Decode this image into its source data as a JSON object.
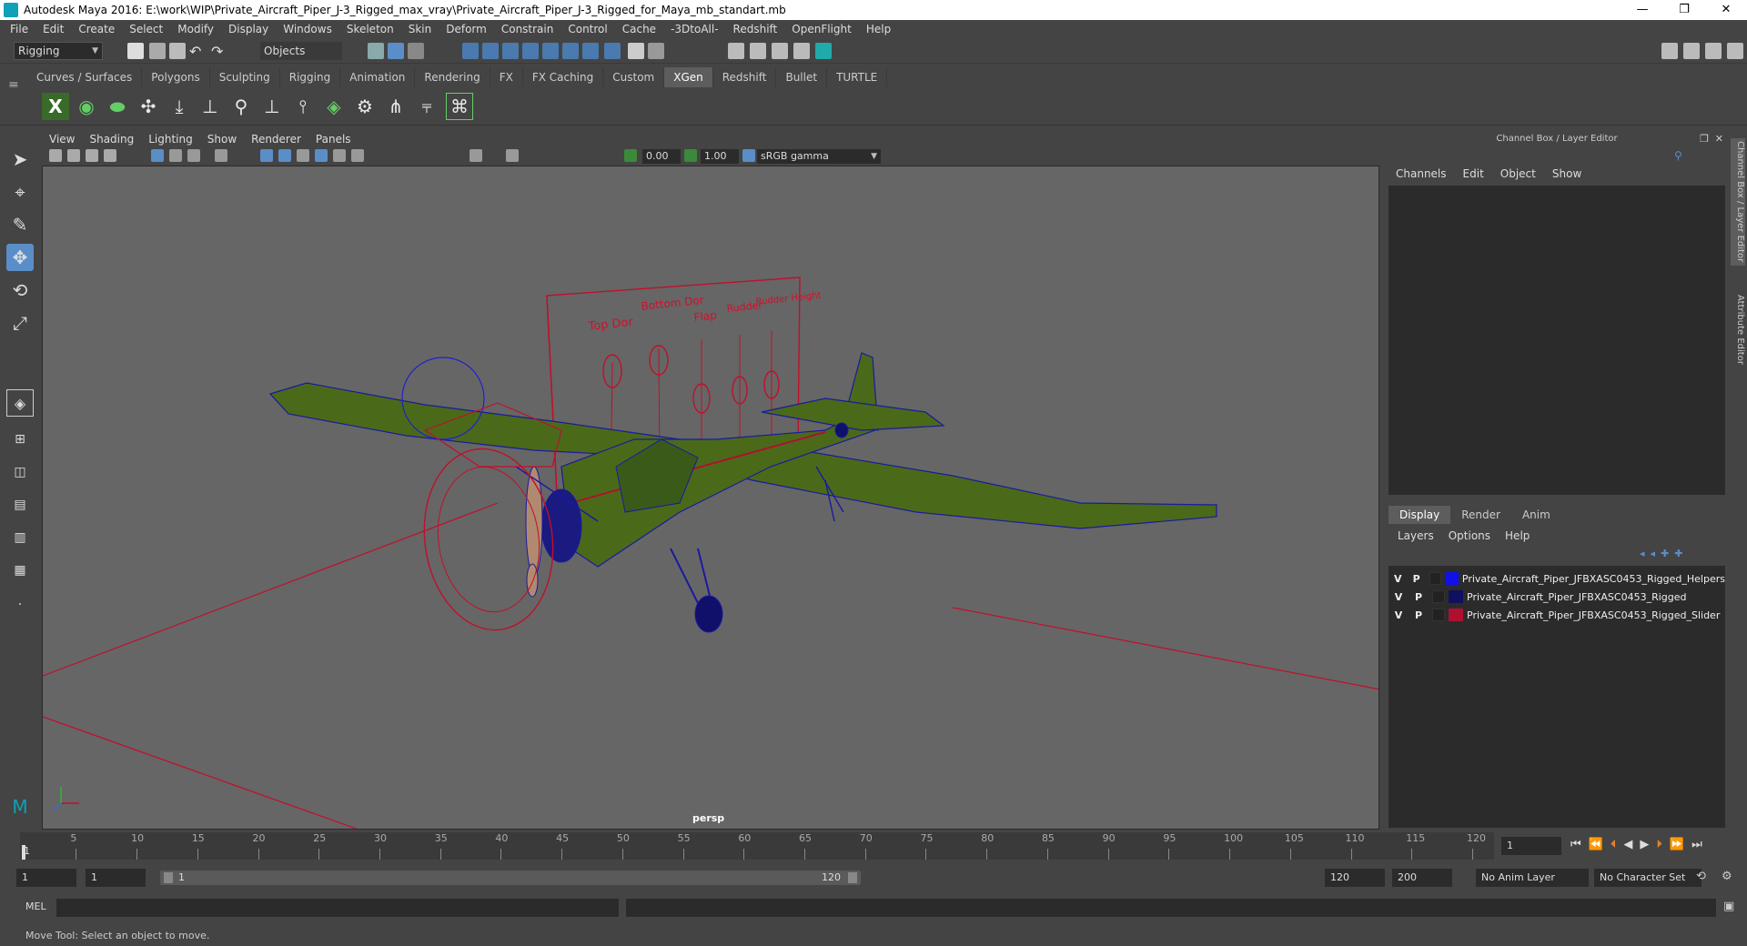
{
  "window": {
    "title": "Autodesk Maya 2016: E:\\work\\WIP\\Private_Aircraft_Piper_J-3_Rigged_max_vray\\Private_Aircraft_Piper_J-3_Rigged_for_Maya_mb_standart.mb",
    "minimize": "—",
    "restore": "❐",
    "close": "✕"
  },
  "menubar": [
    "File",
    "Edit",
    "Create",
    "Select",
    "Modify",
    "Display",
    "Windows",
    "Skeleton",
    "Skin",
    "Deform",
    "Constrain",
    "Control",
    "Cache",
    "-3DtoAll-",
    "Redshift",
    "OpenFlight",
    "Help"
  ],
  "statusline": {
    "mode": "Rigging",
    "selection_mode": "Objects"
  },
  "shelf_tabs": [
    {
      "label": "Curves / Surfaces",
      "active": false
    },
    {
      "label": "Polygons",
      "active": false
    },
    {
      "label": "Sculpting",
      "active": false
    },
    {
      "label": "Rigging",
      "active": false
    },
    {
      "label": "Animation",
      "active": false
    },
    {
      "label": "Rendering",
      "active": false
    },
    {
      "label": "FX",
      "active": false
    },
    {
      "label": "FX Caching",
      "active": false
    },
    {
      "label": "Custom",
      "active": false
    },
    {
      "label": "XGen",
      "active": true
    },
    {
      "label": "Redshift",
      "active": false
    },
    {
      "label": "Bullet",
      "active": false
    },
    {
      "label": "TURTLE",
      "active": false
    }
  ],
  "viewport": {
    "menu": [
      "View",
      "Shading",
      "Lighting",
      "Show",
      "Renderer",
      "Panels"
    ],
    "exposure": "0.00",
    "gamma": "1.00",
    "color_space": "sRGB gamma",
    "camera_label": "persp"
  },
  "slider_board": {
    "labels": [
      "Top Dor",
      "Bottom Dor",
      "Flap",
      "Rudder",
      "Rudder Height"
    ]
  },
  "channel_box": {
    "header": "Channel Box / Layer Editor",
    "menu": [
      "Channels",
      "Edit",
      "Object",
      "Show"
    ]
  },
  "layer_editor": {
    "tabs": [
      {
        "label": "Display",
        "active": true
      },
      {
        "label": "Render",
        "active": false
      },
      {
        "label": "Anim",
        "active": false
      }
    ],
    "menu": [
      "Layers",
      "Options",
      "Help"
    ],
    "layers": [
      {
        "v": "V",
        "p": "P",
        "color": "#1010e8",
        "name": "Private_Aircraft_Piper_JFBXASC0453_Rigged_Helpers"
      },
      {
        "v": "V",
        "p": "P",
        "color": "#101060",
        "name": "Private_Aircraft_Piper_JFBXASC0453_Rigged"
      },
      {
        "v": "V",
        "p": "P",
        "color": "#b01030",
        "name": "Private_Aircraft_Piper_JFBXASC0453_Rigged_Slider"
      }
    ]
  },
  "side_tabs": [
    "Channel Box / Layer Editor",
    "Attribute Editor"
  ],
  "timeline": {
    "start_label": "1",
    "ticks": [
      "5",
      "10",
      "15",
      "20",
      "25",
      "30",
      "35",
      "40",
      "45",
      "50",
      "55",
      "60",
      "65",
      "70",
      "75",
      "80",
      "85",
      "90",
      "95",
      "100",
      "105",
      "110",
      "115",
      "120"
    ],
    "current_frame": "1"
  },
  "range": {
    "start": "1",
    "playback_start": "1",
    "slider_start": "1",
    "slider_end": "120",
    "playback_end": "120",
    "end": "200",
    "anim_layer": "No Anim Layer",
    "character_set": "No Character Set"
  },
  "command_line": {
    "label": "MEL"
  },
  "help_line": {
    "text": "Move Tool: Select an object to move."
  },
  "colors": {
    "accent": "#5a8ec8",
    "viewport_bg": "#666666",
    "wire_red": "#c0102a",
    "wire_blue": "#1a1aa0",
    "mesh_green": "#4a6a1a"
  }
}
